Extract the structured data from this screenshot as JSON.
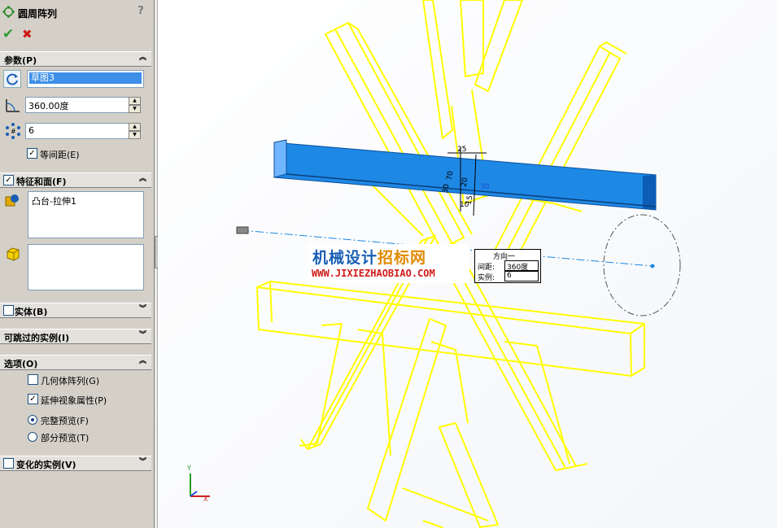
{
  "feature_manager": {
    "title": "圆周阵列",
    "help": "?",
    "ok": "✔",
    "cancel": "✖"
  },
  "params": {
    "header": "参数(P)",
    "axis_value": "草图3",
    "angle_value": "360.00度",
    "instances_value": "6",
    "equal_spacing_label": "等间距(E)",
    "equal_spacing_checked": true
  },
  "features": {
    "header": "特征和面(F)",
    "checked": true,
    "items": [
      "凸台-拉伸1"
    ]
  },
  "collapsed_sections": {
    "bodies": "实体(B)",
    "skip": "可跳过的实例(I)",
    "vary": "变化的实例(V)"
  },
  "options": {
    "header": "选项(O)",
    "geometry_pattern": "几何体阵列(G)",
    "propagate_visual": "延伸视象属性(P)",
    "full_preview": "完整预览(F)",
    "partial_preview": "部分预览(T)"
  },
  "callout": {
    "title": "方向一",
    "spacing_label": "间距:",
    "spacing_value": "360度",
    "instances_label": "实例:",
    "instances_value": "6"
  },
  "watermark": {
    "line1_part1": "机械设计",
    "line1_part2": "招标网",
    "line2": "WWW.JIXIEZHAOBIAO.COM"
  },
  "dimensions": {
    "d1": "25",
    "d2": "70",
    "d3": "20",
    "d4": "30",
    "d5": "30",
    "d6": "15",
    "d7": "10"
  },
  "colors": {
    "preview_yellow": "#ffff00",
    "selected_blue": "#1e88e5",
    "panel_bg": "#d4d0c8"
  }
}
